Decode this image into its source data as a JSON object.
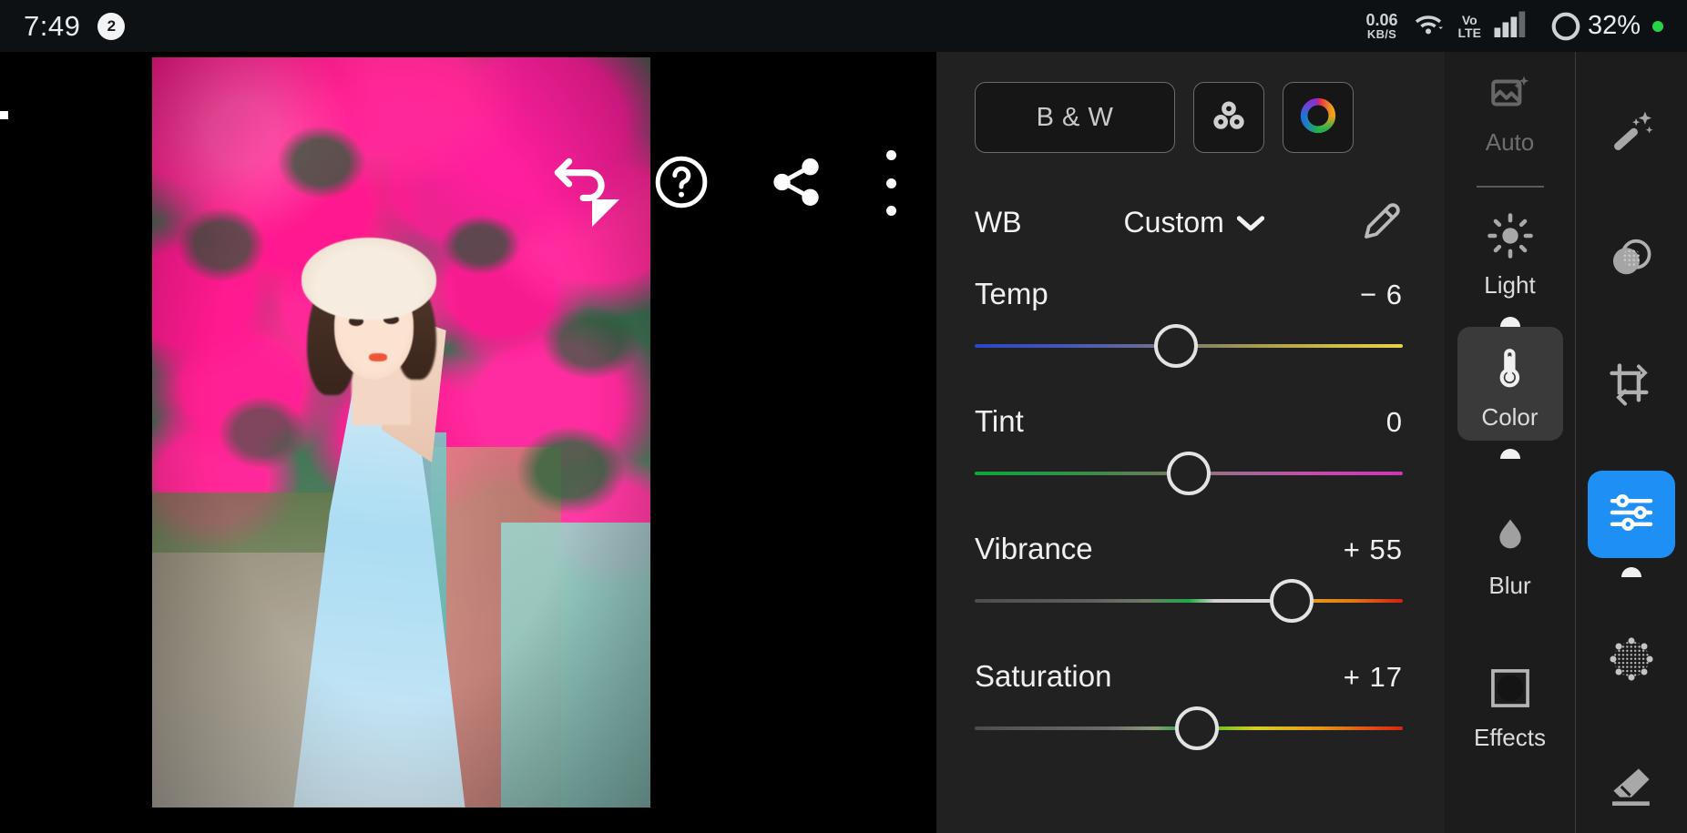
{
  "statusbar": {
    "clock": "7:49",
    "notification_badge": "2",
    "net_speed_value": "0.06",
    "net_speed_unit": "KB/S",
    "wifi_icon": "wifi-icon",
    "volte_line1": "Vo",
    "volte_line2": "LTE",
    "signal_icon": "signal-bars-icon",
    "battery_percent": "32%",
    "recording_dot_color": "#28d24a"
  },
  "canvas": {
    "undo_icon": "undo-arrow-icon",
    "redo_icon": "redo-arrow-icon",
    "help_icon": "help-question-icon",
    "share_icon": "share-icon",
    "more_icon": "more-vertical-icon",
    "photo_alt": "woman-in-white-hat-and-blue-dress-with-pink-bougainvillea"
  },
  "panel": {
    "bw_label": "B & W",
    "color_mix_icon": "color-mix-icon",
    "color_wheel_icon": "color-wheel-icon",
    "wb_label": "WB",
    "wb_value": "Custom",
    "wb_chevron_icon": "chevron-down-icon",
    "eyedropper_icon": "eyedropper-icon",
    "sliders": [
      {
        "name": "Temp",
        "value": "− 6",
        "thumb_percent": 47,
        "gradient": "linear-gradient(90deg,#2b46c8 0%,#4558b8 22%,#6c6f8f 42%,#8f8a5e 56%,#c9b543 80%,#e8d24a 100%)"
      },
      {
        "name": "Tint",
        "value": "0",
        "thumb_percent": 50,
        "gradient": "linear-gradient(90deg,#0aa83c 0%,#3f8a48 28%,#6d7a62 46%,#9b6f8a 58%,#c44cae 80%,#cf35b5 100%)"
      },
      {
        "name": "Vibrance",
        "value": "+ 55",
        "thumb_percent": 74,
        "gradient": "linear-gradient(90deg,#4d4d4d 0%,#5e5e5e 26%,#6f7a66 40%,#1faa46 50%,#cfcfcf 56%,#d8d8d8 68%,#e8a31c 76%,#e07a16 88%,#d31f16 100%)"
      },
      {
        "name": "Saturation",
        "value": "+ 17",
        "thumb_percent": 52,
        "gradient": "linear-gradient(90deg,#4d4d4d 0%,#6a6a6a 30%,#8c9a7e 42%,#17a63f 49%,#6cc024 56%,#d6cf1e 66%,#e69a16 80%,#d92216 100%)"
      }
    ]
  },
  "categories": [
    {
      "label": "Auto",
      "icon": "auto-enhance-icon",
      "state": "dim"
    },
    {
      "label": "Light",
      "icon": "sun-icon",
      "state": "normal"
    },
    {
      "label": "Color",
      "icon": "thermometer-icon",
      "state": "selected"
    },
    {
      "label": "Blur",
      "icon": "droplet-icon",
      "state": "normal"
    },
    {
      "label": "Effects",
      "icon": "vignette-icon",
      "state": "normal"
    }
  ],
  "tools": [
    {
      "icon": "magic-wand-icon",
      "state": "normal"
    },
    {
      "icon": "blend-circles-icon",
      "state": "normal"
    },
    {
      "icon": "crop-rotate-icon",
      "state": "normal"
    },
    {
      "icon": "adjust-sliders-icon",
      "state": "selected"
    },
    {
      "icon": "dotted-circle-icon",
      "state": "normal"
    },
    {
      "icon": "eraser-icon",
      "state": "normal"
    }
  ]
}
